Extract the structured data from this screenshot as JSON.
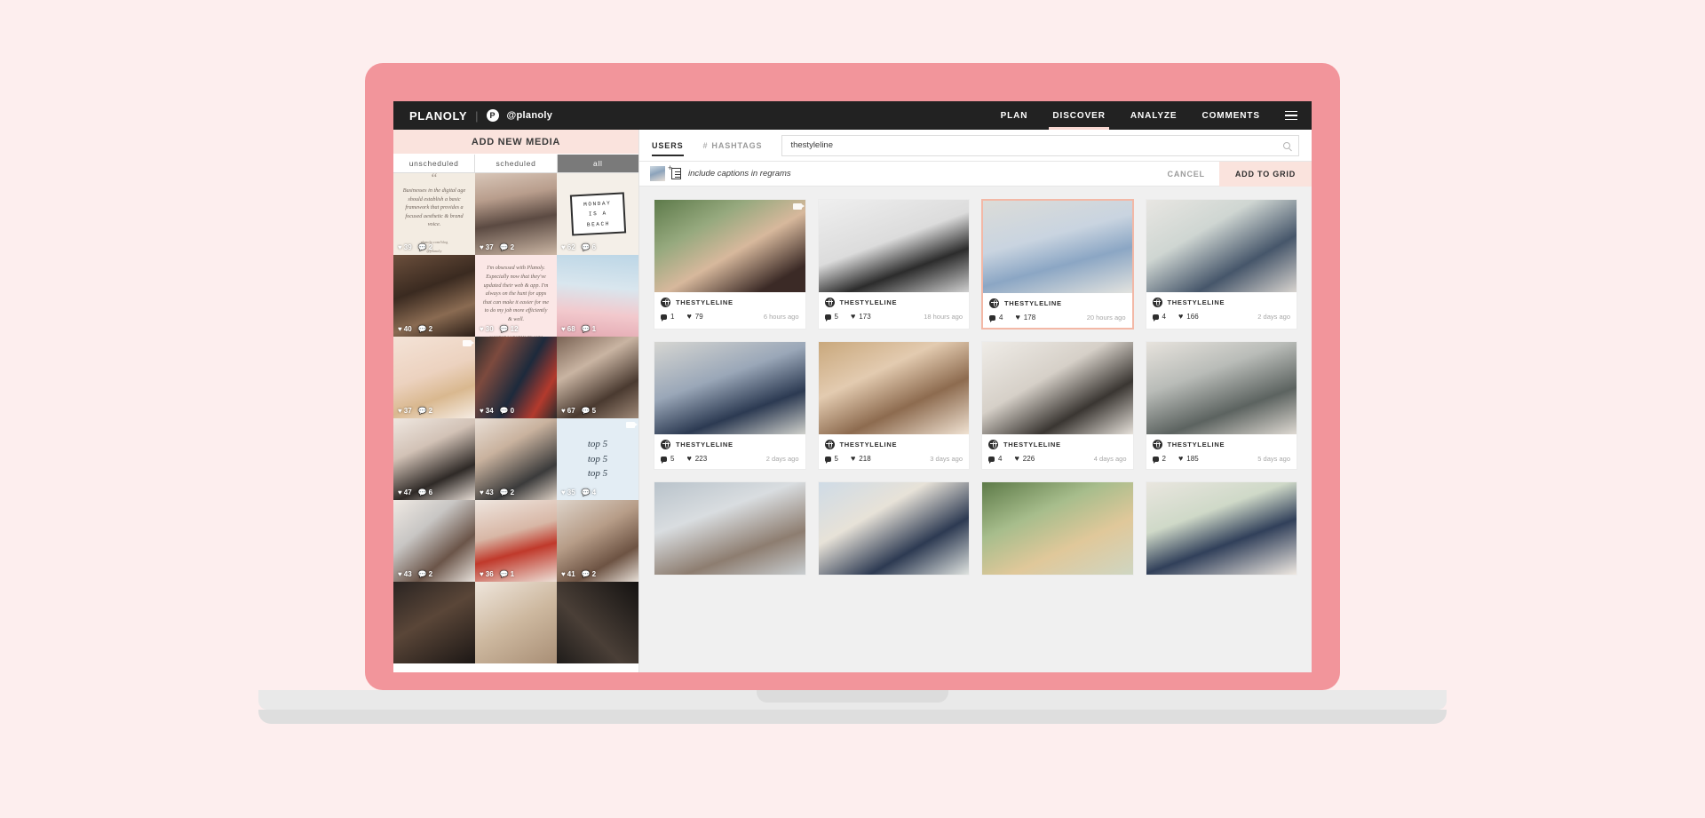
{
  "app": {
    "brand": "PLANOLY",
    "separator": "|",
    "badge": "P",
    "handle": "@planoly",
    "nav": [
      {
        "label": "PLAN",
        "active": false
      },
      {
        "label": "DISCOVER",
        "active": true
      },
      {
        "label": "ANALYZE",
        "active": false
      },
      {
        "label": "COMMENTS",
        "active": false
      }
    ],
    "menu_icon": "hamburger-menu-icon"
  },
  "left_panel": {
    "header": "ADD NEW MEDIA",
    "tabs": [
      {
        "label": "unscheduled",
        "active": false
      },
      {
        "label": "scheduled",
        "active": false
      },
      {
        "label": "all",
        "active": true
      }
    ],
    "tiles": [
      {
        "kind": "quote",
        "quote_mark": "“",
        "text": "Businesses in the digital age should establish a basic framework that provides a focused aesthetic & brand voice.",
        "footer": "planoly.com/blog",
        "footer2": "@planoly",
        "likes": "39",
        "comments": "2",
        "video": false
      },
      {
        "kind": "photo",
        "style": "boutique-woman",
        "likes": "37",
        "comments": "2",
        "video": false
      },
      {
        "kind": "lightbox",
        "lines": [
          "MONDAY",
          "IS A",
          "BEACH"
        ],
        "likes": "62",
        "comments": "6",
        "video": false
      },
      {
        "kind": "photo",
        "style": "elevator-mirror",
        "likes": "40",
        "comments": "2",
        "video": false
      },
      {
        "kind": "quote",
        "quote_mark": "“",
        "text": "I'm obsessed with Planoly. Especially now that they've updated their web & app. I'm always on the hunt for apps that can make it easier for me to do my job more efficiently & well.",
        "footer": "@AURORA@BORMLIFE.COM",
        "footer2": "",
        "likes": "30",
        "comments": "12",
        "video": false
      },
      {
        "kind": "photo",
        "style": "pink-roses",
        "likes": "68",
        "comments": "1",
        "video": false
      },
      {
        "kind": "photo",
        "style": "gold-key",
        "likes": "37",
        "comments": "2",
        "video": true
      },
      {
        "kind": "photo",
        "style": "book-stack",
        "likes": "34",
        "comments": "0",
        "video": false
      },
      {
        "kind": "photo",
        "style": "phone-hand",
        "likes": "67",
        "comments": "5",
        "video": false
      },
      {
        "kind": "photo",
        "style": "desk-writing",
        "likes": "47",
        "comments": "6",
        "video": false
      },
      {
        "kind": "photo",
        "style": "laptop-phone",
        "likes": "43",
        "comments": "2",
        "video": false
      },
      {
        "kind": "top5",
        "lines": [
          "top 5",
          "top 5",
          "top 5"
        ],
        "likes": "35",
        "comments": "4",
        "video": true
      },
      {
        "kind": "photo",
        "style": "marble-desk",
        "likes": "43",
        "comments": "2",
        "video": false
      },
      {
        "kind": "photo",
        "style": "cocktail",
        "likes": "36",
        "comments": "1",
        "video": false
      },
      {
        "kind": "photo",
        "style": "chair-bag",
        "likes": "41",
        "comments": "2",
        "video": false
      },
      {
        "kind": "photo",
        "style": "dark-shelf",
        "likes": "",
        "comments": "",
        "video": false
      },
      {
        "kind": "photo",
        "style": "light-wood",
        "likes": "",
        "comments": "",
        "video": false
      },
      {
        "kind": "photo",
        "style": "pattern-dark",
        "likes": "",
        "comments": "",
        "video": false
      }
    ]
  },
  "discover": {
    "search_tabs": [
      {
        "label": "USERS",
        "active": true,
        "icon": ""
      },
      {
        "label": "HASHTAGS",
        "active": false,
        "icon": "#"
      }
    ],
    "search_value": "thestyleline",
    "search_placeholder": "search",
    "search_icon": "search-icon",
    "captions_label": "include captions in regrams",
    "cancel_label": "CANCEL",
    "add_to_grid_label": "ADD TO GRID",
    "accent_color": "#fae3dd",
    "selected_border_color": "#f3b8a6",
    "posts": [
      {
        "username": "THESTYLELINE",
        "comments": "1",
        "likes": "79",
        "time": "6 hours ago",
        "selected": false,
        "video": true,
        "style": "woman-plant"
      },
      {
        "username": "THESTYLELINE",
        "comments": "5",
        "likes": "173",
        "time": "18 hours ago",
        "selected": false,
        "video": false,
        "style": "wall-letters"
      },
      {
        "username": "THESTYLELINE",
        "comments": "4",
        "likes": "178",
        "time": "20 hours ago",
        "selected": true,
        "video": false,
        "style": "blue-dress"
      },
      {
        "username": "THESTYLELINE",
        "comments": "4",
        "likes": "166",
        "time": "2 days ago",
        "selected": false,
        "video": false,
        "style": "sofa-map"
      },
      {
        "username": "THESTYLELINE",
        "comments": "5",
        "likes": "223",
        "time": "2 days ago",
        "selected": false,
        "video": false,
        "style": "denim-walk"
      },
      {
        "username": "THESTYLELINE",
        "comments": "5",
        "likes": "218",
        "time": "3 days ago",
        "selected": false,
        "video": false,
        "style": "two-friends"
      },
      {
        "username": "THESTYLELINE",
        "comments": "4",
        "likes": "226",
        "time": "4 days ago",
        "selected": false,
        "video": false,
        "style": "desk-lamp"
      },
      {
        "username": "THESTYLELINE",
        "comments": "2",
        "likes": "185",
        "time": "5 days ago",
        "selected": false,
        "video": false,
        "style": "grey-shirt"
      },
      {
        "username": "",
        "comments": "",
        "likes": "",
        "time": "",
        "selected": false,
        "video": false,
        "style": "street-white"
      },
      {
        "username": "",
        "comments": "",
        "likes": "",
        "time": "",
        "selected": false,
        "video": false,
        "style": "studio-rack"
      },
      {
        "username": "",
        "comments": "",
        "likes": "",
        "time": "",
        "selected": false,
        "video": false,
        "style": "blonde-outdoor"
      },
      {
        "username": "",
        "comments": "",
        "likes": "",
        "time": "",
        "selected": false,
        "video": false,
        "style": "tote-flowers"
      }
    ]
  }
}
